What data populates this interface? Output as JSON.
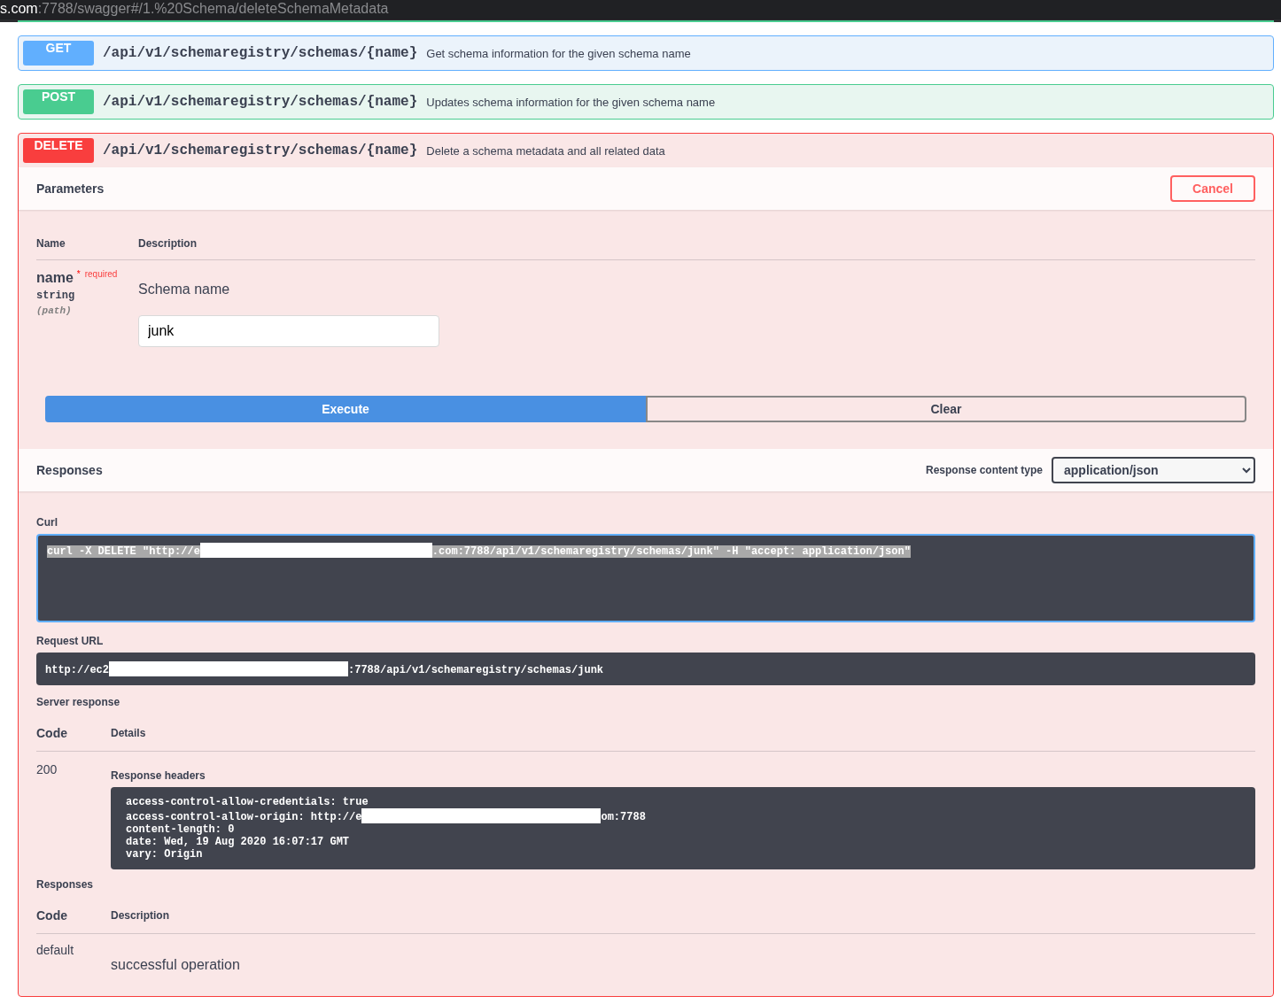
{
  "address_bar": {
    "host": "s.com",
    "path": ":7788/swagger#/1.%20Schema/deleteSchemaMetadata"
  },
  "operations": [
    {
      "method": "GET",
      "kind": "get",
      "path": "/api/v1/schemaregistry/schemas/{name}",
      "summary": "Get schema information for the given schema name",
      "expanded": false
    },
    {
      "method": "POST",
      "kind": "post",
      "path": "/api/v1/schemaregistry/schemas/{name}",
      "summary": "Updates schema information for the given schema name",
      "expanded": false
    },
    {
      "method": "DELETE",
      "kind": "delete",
      "path": "/api/v1/schemaregistry/schemas/{name}",
      "summary": "Delete a schema metadata and all related data",
      "expanded": true
    }
  ],
  "detail": {
    "parameters_title": "Parameters",
    "cancel_button": "Cancel",
    "param_columns": [
      "Name",
      "Description"
    ],
    "parameter": {
      "name": "name",
      "required_mark": "*",
      "required_label": "required",
      "type": "string",
      "location": "(path)",
      "description": "Schema name",
      "value": "junk"
    },
    "execute_button": "Execute",
    "clear_button": "Clear",
    "responses_title": "Responses",
    "content_type_label": "Response content type",
    "content_type": "application/json",
    "curl_label": "Curl",
    "curl_before": "curl -X DELETE \"http://e",
    "curl_after": ".com:7788/api/v1/schemaregistry/schemas/junk\" -H \"accept: application/json\"",
    "request_url_label": "Request URL",
    "request_url_before": "http://ec2",
    "request_url_after": ":7788/api/v1/schemaregistry/schemas/junk",
    "server_response_label": "Server response",
    "server_columns": [
      "Code",
      "Details"
    ],
    "server_code": "200",
    "headers_label": "Response headers",
    "headers": [
      {
        "before": "access-control-allow-credentials: true"
      },
      {
        "before": "access-control-allow-origin: http://e",
        "redacted": true,
        "after": "om:7788"
      },
      {
        "before": "content-length: 0"
      },
      {
        "before": "date: Wed, 19 Aug 2020 16:07:17 GMT"
      },
      {
        "before": "vary: Origin"
      }
    ],
    "responses_label": "Responses",
    "response_columns": [
      "Code",
      "Description"
    ],
    "response_code": "default",
    "response_description": "successful operation"
  }
}
